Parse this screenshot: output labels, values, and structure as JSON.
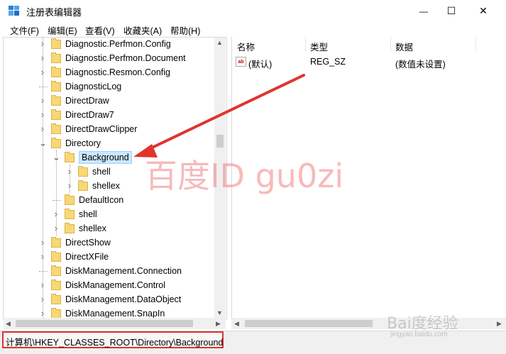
{
  "window": {
    "title": "注册表编辑器",
    "minimize_glyph": "—",
    "maximize_glyph": "☐",
    "close_glyph": "✕"
  },
  "menu": [
    "文件(F)",
    "编辑(E)",
    "查看(V)",
    "收藏夹(A)",
    "帮助(H)"
  ],
  "tree": {
    "items": [
      {
        "label": "Diagnostic.Perfmon.Config",
        "level": 0,
        "expander": "chevron-right"
      },
      {
        "label": "Diagnostic.Perfmon.Document",
        "level": 0,
        "expander": "chevron-right"
      },
      {
        "label": "Diagnostic.Resmon.Config",
        "level": 0,
        "expander": "chevron-right"
      },
      {
        "label": "DiagnosticLog",
        "level": 0,
        "expander": "none"
      },
      {
        "label": "DirectDraw",
        "level": 0,
        "expander": "chevron-right"
      },
      {
        "label": "DirectDraw7",
        "level": 0,
        "expander": "chevron-right"
      },
      {
        "label": "DirectDrawClipper",
        "level": 0,
        "expander": "chevron-right"
      },
      {
        "label": "Directory",
        "level": 0,
        "expander": "chevron-down"
      },
      {
        "label": "Background",
        "level": 1,
        "expander": "chevron-down",
        "selected": true
      },
      {
        "label": "shell",
        "level": 2,
        "expander": "chevron-right"
      },
      {
        "label": "shellex",
        "level": 2,
        "expander": "chevron-right"
      },
      {
        "label": "DefaultIcon",
        "level": 1,
        "expander": "none"
      },
      {
        "label": "shell",
        "level": 1,
        "expander": "chevron-right"
      },
      {
        "label": "shellex",
        "level": 1,
        "expander": "chevron-right"
      },
      {
        "label": "DirectShow",
        "level": 0,
        "expander": "chevron-right"
      },
      {
        "label": "DirectXFile",
        "level": 0,
        "expander": "chevron-right"
      },
      {
        "label": "DiskManagement.Connection",
        "level": 0,
        "expander": "none"
      },
      {
        "label": "DiskManagement.Control",
        "level": 0,
        "expander": "chevron-right"
      },
      {
        "label": "DiskManagement.DataObject",
        "level": 0,
        "expander": "chevron-right"
      },
      {
        "label": "DiskManagement.SnapIn",
        "level": 0,
        "expander": "chevron-right"
      }
    ]
  },
  "list": {
    "columns": [
      "名称",
      "类型",
      "数据"
    ],
    "rows": [
      {
        "name": "(默认)",
        "type": "REG_SZ",
        "data": "(数值未设置)",
        "icon_text": "ab"
      }
    ]
  },
  "statusbar": {
    "path": "计算机\\HKEY_CLASSES_ROOT\\Directory\\Background"
  },
  "watermark": {
    "text": "百度ID gu0zi",
    "baidu_mark": "Bai度经验",
    "baidu_url": "jingyan.baidu.com"
  },
  "colors": {
    "annotation_red": "#e0342d",
    "selection_bg": "#cce8ff",
    "folder_yellow": "#f8d775"
  }
}
